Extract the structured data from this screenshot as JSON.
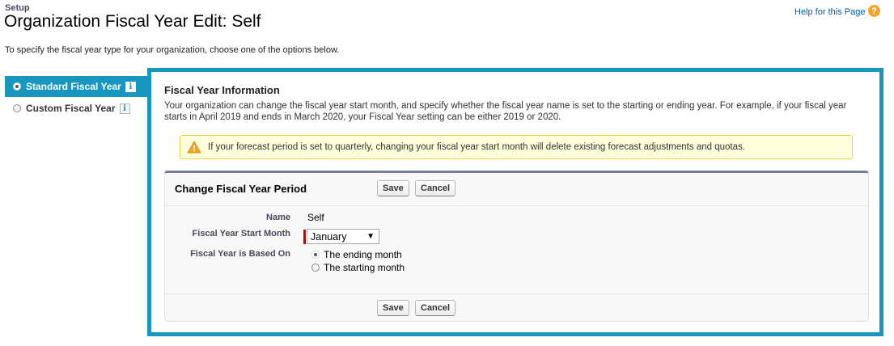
{
  "header": {
    "breadcrumb": "Setup",
    "title": "Organization Fiscal Year Edit: Self",
    "help_link": "Help for this Page",
    "help_icon_glyph": "?"
  },
  "intro": "To specify the fiscal year type for your organization, choose one of the options below.",
  "fiscal_types": [
    {
      "label": "Standard Fiscal Year",
      "selected": true
    },
    {
      "label": "Custom Fiscal Year",
      "selected": false
    }
  ],
  "info_glyph": "i",
  "info_section": {
    "title": "Fiscal Year Information",
    "description": "Your organization can change the fiscal year start month, and specify whether the fiscal year name is set to the starting or ending year. For example, if your fiscal year starts in April 2019 and ends in March 2020, your Fiscal Year setting can be either 2019 or 2020."
  },
  "warning": {
    "text": "If your forecast period is set to quarterly, changing your fiscal year start month will delete existing forecast adjustments and quotas."
  },
  "panel": {
    "title": "Change Fiscal Year Period",
    "save_label": "Save",
    "cancel_label": "Cancel"
  },
  "form": {
    "name_label": "Name",
    "name_value": "Self",
    "start_month_label": "Fiscal Year Start Month",
    "start_month_value": "January",
    "based_on_label": "Fiscal Year is Based On",
    "based_on_options": [
      {
        "label": "The ending month",
        "selected": true
      },
      {
        "label": "The starting month",
        "selected": false
      }
    ]
  },
  "colors": {
    "accent": "#1797c0",
    "warning_bg": "#ffffdc",
    "required": "#cc0000"
  }
}
